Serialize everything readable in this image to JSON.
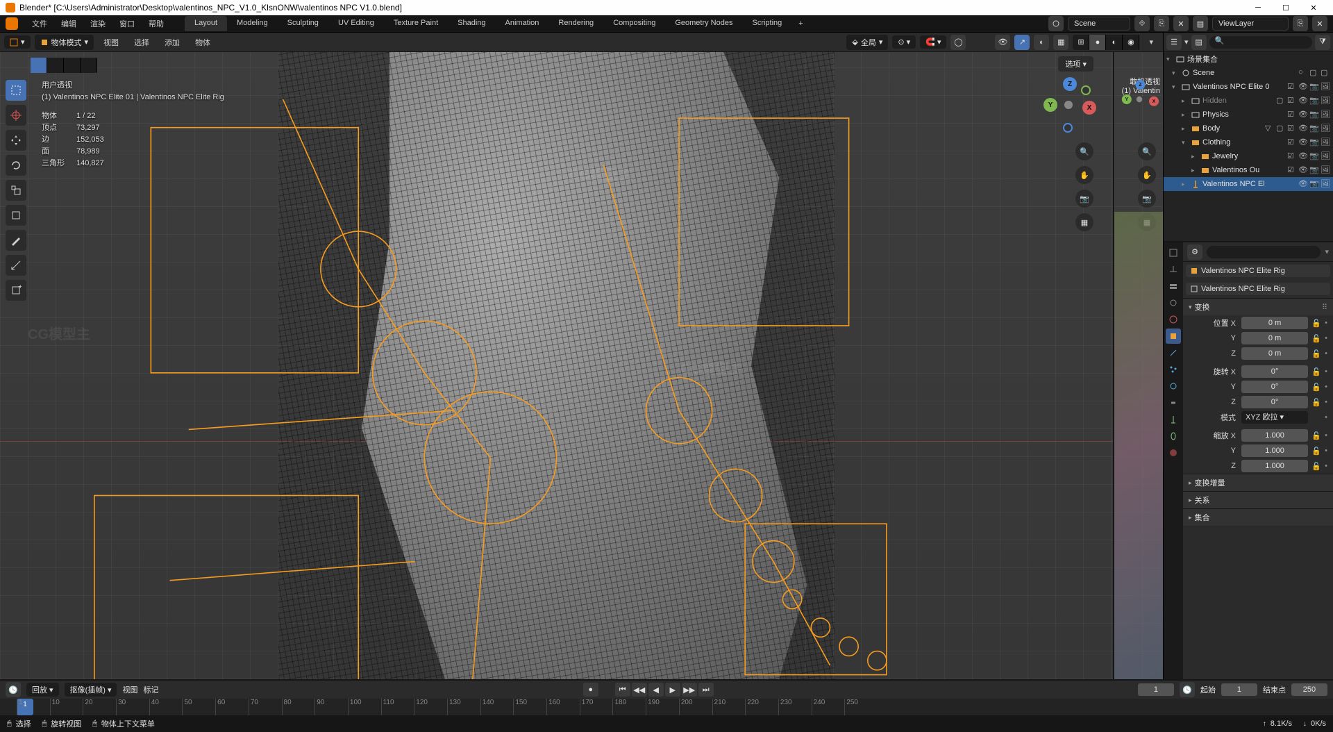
{
  "window": {
    "title": "Blender* [C:\\Users\\Administrator\\Desktop\\valentinos_NPC_V1.0_KlsnONW\\valentinos NPC V1.0.blend]"
  },
  "menubar": {
    "items": [
      "文件",
      "编辑",
      "渲染",
      "窗口",
      "帮助"
    ],
    "workspaces": [
      "Layout",
      "Modeling",
      "Sculpting",
      "UV Editing",
      "Texture Paint",
      "Shading",
      "Animation",
      "Rendering",
      "Compositing",
      "Geometry Nodes",
      "Scripting"
    ],
    "active_workspace": 0,
    "scene_label": "Scene",
    "viewlayer_label": "ViewLayer"
  },
  "viewport_header": {
    "mode": "物体模式",
    "menus": [
      "视图",
      "选择",
      "添加",
      "物体"
    ],
    "global": "全局",
    "options": "选项"
  },
  "overlay_left": {
    "title": "用户透视",
    "subtitle": "(1) Valentinos NPC Elite 01 | Valentinos NPC Elite Rig",
    "stats": [
      {
        "label": "物体",
        "value": "1 / 22"
      },
      {
        "label": "顶点",
        "value": "73,297"
      },
      {
        "label": "边",
        "value": "152,053"
      },
      {
        "label": "面",
        "value": "78,989"
      },
      {
        "label": "三角形",
        "value": "140,827"
      }
    ]
  },
  "overlay_right": {
    "title": "敢机透视",
    "subtitle": "(1) Valentin"
  },
  "gizmo_axes": {
    "x": "X",
    "y": "Y",
    "z": "Z"
  },
  "outliner": {
    "root": "场景集合",
    "items": [
      {
        "indent": 0,
        "expand": "▾",
        "icon": "scene",
        "name": "Scene",
        "ricons": [
          "circle",
          "square",
          "square"
        ]
      },
      {
        "indent": 0,
        "expand": "▾",
        "icon": "coll",
        "name": "Valentinos NPC Elite 0",
        "ricons": [
          "check",
          "eye",
          "cam",
          "render"
        ]
      },
      {
        "indent": 1,
        "expand": "▸",
        "icon": "coll",
        "name": "Hidden",
        "ricons": [
          "box",
          "check",
          "eye",
          "cam",
          "render"
        ],
        "dim": true
      },
      {
        "indent": 1,
        "expand": "▸",
        "icon": "coll",
        "name": "Physics",
        "ricons": [
          "check",
          "eye",
          "cam",
          "render"
        ]
      },
      {
        "indent": 1,
        "expand": "▸",
        "icon": "coll-c",
        "name": "Body",
        "ricons": [
          "tri",
          "box",
          "check",
          "eye",
          "cam",
          "render"
        ]
      },
      {
        "indent": 1,
        "expand": "▾",
        "icon": "coll-c",
        "name": "Clothing",
        "ricons": [
          "check",
          "eye",
          "cam",
          "render"
        ]
      },
      {
        "indent": 2,
        "expand": "▸",
        "icon": "coll-c",
        "name": "Jewelry",
        "ricons": [
          "check",
          "eye",
          "cam",
          "render"
        ]
      },
      {
        "indent": 2,
        "expand": "▸",
        "icon": "coll-c",
        "name": "Valentinos Ou",
        "ricons": [
          "check",
          "eye",
          "cam",
          "render"
        ]
      },
      {
        "indent": 1,
        "expand": "▸",
        "icon": "arm",
        "name": "Valentinos NPC El",
        "ricons": [
          "eye",
          "cam",
          "render"
        ],
        "sel": true
      }
    ]
  },
  "properties": {
    "breadcrumb1": "Valentinos NPC Elite Rig",
    "breadcrumb2": "Valentinos NPC Elite Rig",
    "panels": {
      "transform": {
        "title": "变换",
        "loc_label": "位置",
        "rot_label": "旋转",
        "scale_label": "缩放",
        "mode_label": "模式",
        "mode_value": "XYZ 欧拉",
        "loc": {
          "x": "0 m",
          "y": "0 m",
          "z": "0 m"
        },
        "rot": {
          "x": "0°",
          "y": "0°",
          "z": "0°"
        },
        "scale": {
          "x": "1.000",
          "y": "1.000",
          "z": "1.000"
        }
      },
      "collapsed": [
        "变换增量",
        "关系",
        "集合"
      ]
    }
  },
  "timeline": {
    "playback": "回放",
    "keying": "抠像(插帧)",
    "menus": [
      "视图",
      "标记"
    ],
    "start_label": "起始",
    "end_label": "结束点",
    "current": "1",
    "start": "1",
    "end": "250",
    "ticks": [
      "1",
      "10",
      "20",
      "30",
      "40",
      "50",
      "60",
      "70",
      "80",
      "90",
      "100",
      "110",
      "120",
      "130",
      "140",
      "150",
      "160",
      "170",
      "180",
      "190",
      "200",
      "210",
      "220",
      "230",
      "240",
      "250"
    ]
  },
  "statusbar": {
    "select": "选择",
    "rotate": "旋转视图",
    "context": "物体上下文菜单",
    "net_up": "8.1K/s",
    "net_down": "0K/s"
  }
}
